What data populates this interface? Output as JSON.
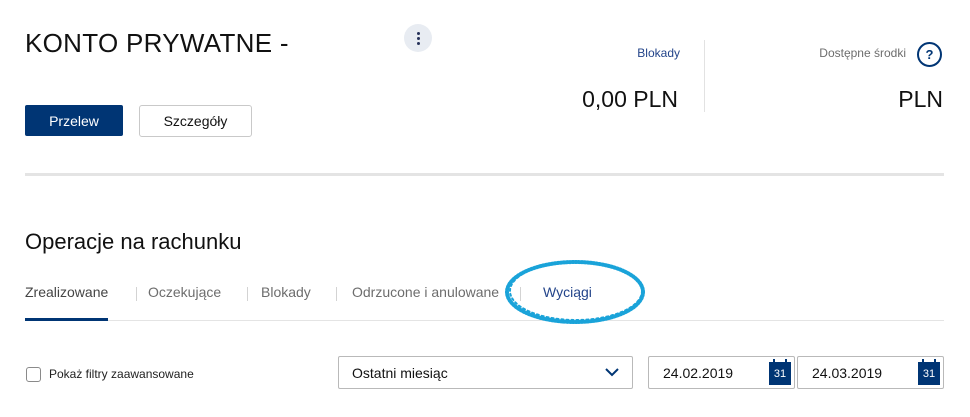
{
  "account": {
    "title": "KONTO PRYWATNE -",
    "more_icon": "vertical-dots-icon"
  },
  "actions": {
    "transfer_label": "Przelew",
    "details_label": "Szczegóły"
  },
  "balances": {
    "blocked_label": "Blokady",
    "blocked_amount": "0,00 PLN",
    "available_label": "Dostępne środki",
    "available_amount": "PLN",
    "help_icon": "question-circle-icon",
    "help_symbol": "?"
  },
  "operations": {
    "title": "Operacje na rachunku",
    "tabs": [
      {
        "label": "Zrealizowane",
        "active": true
      },
      {
        "label": "Oczekujące"
      },
      {
        "label": "Blokady"
      },
      {
        "label": "Odrzucone i anulowane"
      },
      {
        "label": "Wyciągi",
        "highlighted": true
      }
    ]
  },
  "filters": {
    "advanced_label": "Pokaż filtry zaawansowane",
    "advanced_checked": false,
    "period_value": "Ostatni miesiąc",
    "date_from": "24.02.2019",
    "date_to": "24.03.2019",
    "calendar_icon_text": "31"
  },
  "colors": {
    "brand_navy": "#003574",
    "link_blue": "#23448a",
    "annotation_cyan": "#1aa3d9"
  }
}
